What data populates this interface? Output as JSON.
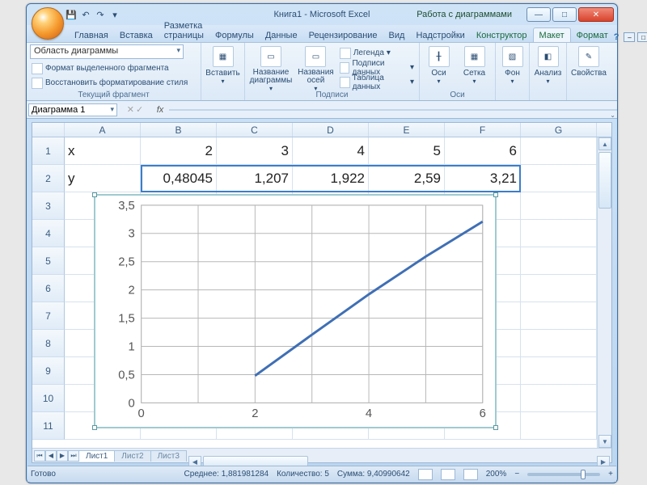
{
  "title": "Книга1 - Microsoft Excel",
  "contextual_title": "Работа с диаграммами",
  "tabs": {
    "home": "Главная",
    "insert": "Вставка",
    "layout": "Разметка страницы",
    "formulas": "Формулы",
    "data": "Данные",
    "review": "Рецензирование",
    "view": "Вид",
    "addins": "Надстройки",
    "design": "Конструктор",
    "chart_layout": "Макет",
    "format": "Формат"
  },
  "ribbon": {
    "selection_combo": "Область диаграммы",
    "fmt_sel": "Формат выделенного фрагмента",
    "reset": "Восстановить форматирование стиля",
    "group_selection": "Текущий фрагмент",
    "insert": "Вставить",
    "chart_title": "Название диаграммы",
    "axis_titles": "Названия осей",
    "legend": "Легенда",
    "data_labels": "Подписи данных",
    "data_table": "Таблица данных",
    "group_labels": "Подписи",
    "axes": "Оси",
    "grid": "Сетка",
    "group_axes": "Оси",
    "bg": "Фон",
    "analysis": "Анализ",
    "props": "Свойства"
  },
  "namebox": "Диаграмма 1",
  "columns": [
    "A",
    "B",
    "C",
    "D",
    "E",
    "F",
    "G"
  ],
  "rows": [
    "1",
    "2",
    "3",
    "4",
    "5",
    "6",
    "7",
    "8",
    "9",
    "10",
    "11"
  ],
  "cells": {
    "A1": "x",
    "B1": "2",
    "C1": "3",
    "D1": "4",
    "E1": "5",
    "F1": "6",
    "A2": "y",
    "B2": "0,48045",
    "C2": "1,207",
    "D2": "1,922",
    "E2": "2,59",
    "F2": "3,21"
  },
  "sheets": {
    "s1": "Лист1",
    "s2": "Лист2",
    "s3": "Лист3"
  },
  "status": {
    "ready": "Готово",
    "avg": "Среднее: 1,881981284",
    "count": "Количество: 5",
    "sum": "Сумма: 9,40990642",
    "zoom": "200%"
  },
  "chart_data": {
    "type": "line",
    "x": [
      2,
      3,
      4,
      5,
      6
    ],
    "values": [
      0.48045,
      1.207,
      1.922,
      2.59,
      3.21
    ],
    "xlim": [
      0,
      6
    ],
    "ylim": [
      0,
      3.5
    ],
    "xticks": [
      0,
      2,
      4,
      6
    ],
    "yticks": [
      0,
      0.5,
      1,
      1.5,
      2,
      2.5,
      3,
      3.5
    ],
    "ytick_labels": [
      "0",
      "0,5",
      "1",
      "1,5",
      "2",
      "2,5",
      "3",
      "3,5"
    ]
  }
}
